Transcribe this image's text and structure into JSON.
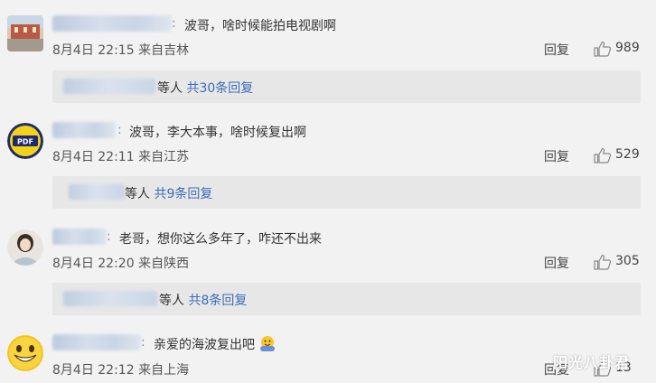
{
  "comments": [
    {
      "text": "波哥，啥时候能拍电视剧啊",
      "time": "8月4日 22:15",
      "location": "来自吉林",
      "reply_label": "回复",
      "likes": "989",
      "sub": {
        "suffix": "等人",
        "link": "共30条回复"
      }
    },
    {
      "text": "波哥，李大本事，啥时候复出啊",
      "time": "8月4日 22:11",
      "location": "来自江苏",
      "reply_label": "回复",
      "likes": "529",
      "avatar_text": "PDF",
      "sub": {
        "suffix": "等人",
        "link": "共9条回复"
      }
    },
    {
      "text": "老哥，想你这么多年了，咋还不出来",
      "time": "8月4日 22:20",
      "location": "来自陕西",
      "reply_label": "回复",
      "likes": "305",
      "sub": {
        "suffix": "等人",
        "link": "共8条回复"
      }
    },
    {
      "text": "亲爱的海波复出吧",
      "time": "8月4日 22:12",
      "location": "来自上海",
      "reply_label": "回复",
      "likes": "13"
    }
  ],
  "watermark": "阳光八卦君",
  "colors": {
    "link": "#3b6cb7",
    "background": "#f2f2f2",
    "subbox": "#e7e7e7"
  }
}
